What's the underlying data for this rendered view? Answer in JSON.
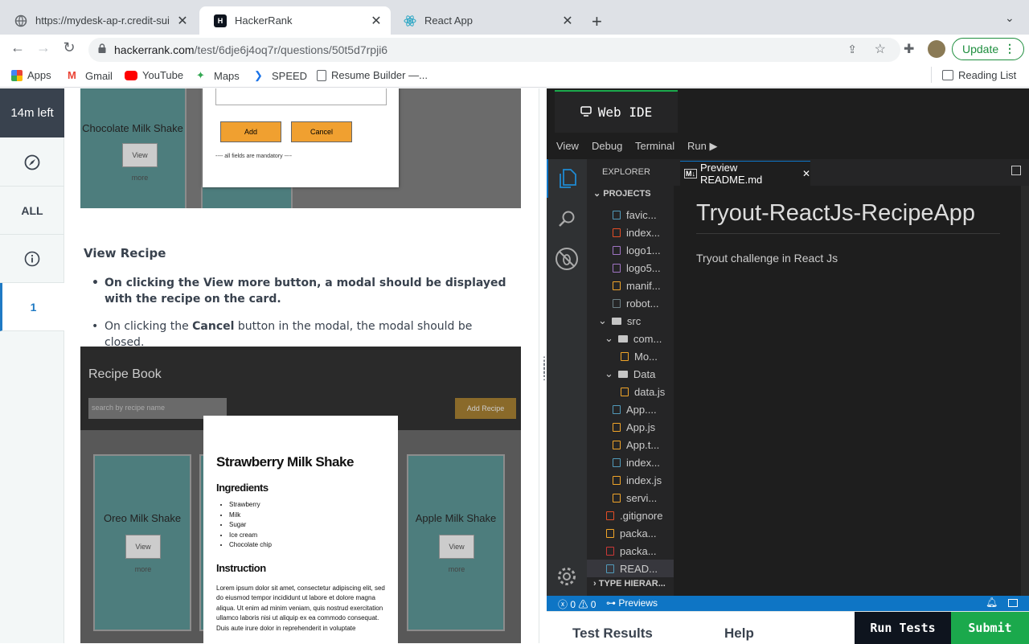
{
  "browser": {
    "tabs": [
      {
        "title": "https://mydesk-ap-r.credit-sui",
        "active": false
      },
      {
        "title": "HackerRank",
        "active": true
      },
      {
        "title": "React App",
        "active": false
      }
    ],
    "url_host": "hackerrank.com",
    "url_path": "/test/6dje6j4oq7r/questions/50t5d7rpji6",
    "update_label": "Update",
    "bookmarks": [
      "Apps",
      "Gmail",
      "YouTube",
      "Maps",
      "SPEED",
      "Resume Builder —...",
      "Reading List"
    ]
  },
  "rail": {
    "time_left": "14m left",
    "all_label": "ALL",
    "question_number": "1"
  },
  "question": {
    "section_title": "View Recipe",
    "bullet1_bold_a": "On clicking the View more button, a modal should be displayed with the recipe on the card.",
    "bullet2_pre": "On clicking the ",
    "bullet2_bold": "Cancel",
    "bullet2_post": " button in the modal, the modal should be closed.",
    "image1": {
      "card_title": "Chocolate Milk Shake",
      "view_more": "View more",
      "add": "Add",
      "cancel": "Cancel",
      "note": "---- all fields are mandatory ----"
    },
    "image2": {
      "app_title": "Recipe Book",
      "search_placeholder": "search by recipe name",
      "add_recipe": "Add Recipe",
      "modal_title": "Strawberry Milk Shake",
      "ingredients_heading": "Ingredients",
      "ingredients": [
        "Strawberry",
        "Milk",
        "Sugar",
        "Ice cream",
        "Chocolate chip"
      ],
      "instruction_heading": "Instruction",
      "instruction_text": "Lorem ipsum dolor sit amet, consectetur adipiscing elit, sed do eiusmod tempor incididunt ut labore et dolore magna aliqua. Ut enim ad minim veniam, quis nostrud exercitation ullamco laboris nisi ut aliquip ex ea commodo consequat. Duis aute irure dolor in reprehenderit in voluptate",
      "left_card": "Oreo Milk Shake",
      "right_card": "Apple Milk Shake",
      "view_more": "View more"
    }
  },
  "ide": {
    "title": "Web IDE",
    "menu": [
      "View",
      "Debug",
      "Terminal",
      "Run ▶"
    ],
    "explorer_label": "EXPLORER",
    "projects_label": "PROJECTS",
    "tree": [
      {
        "name": "favic...",
        "indent": 2,
        "kind": "file",
        "color": "#519aba"
      },
      {
        "name": "index...",
        "indent": 2,
        "kind": "file",
        "color": "#e44d26"
      },
      {
        "name": "logo1...",
        "indent": 2,
        "kind": "file",
        "color": "#a074c4"
      },
      {
        "name": "logo5...",
        "indent": 2,
        "kind": "file",
        "color": "#a074c4"
      },
      {
        "name": "manif...",
        "indent": 2,
        "kind": "file",
        "color": "#f1a529"
      },
      {
        "name": "robot...",
        "indent": 2,
        "kind": "file",
        "color": "#6d8086"
      },
      {
        "name": "src",
        "indent": 1,
        "kind": "folder"
      },
      {
        "name": "com...",
        "indent": 2,
        "kind": "folder"
      },
      {
        "name": "Mo...",
        "indent": 3,
        "kind": "file",
        "color": "#f1a529"
      },
      {
        "name": "Data",
        "indent": 2,
        "kind": "folder"
      },
      {
        "name": "data.js",
        "indent": 3,
        "kind": "file",
        "color": "#f1a529"
      },
      {
        "name": "App....",
        "indent": 2,
        "kind": "file",
        "color": "#519aba"
      },
      {
        "name": "App.js",
        "indent": 2,
        "kind": "file",
        "color": "#f1a529"
      },
      {
        "name": "App.t...",
        "indent": 2,
        "kind": "file",
        "color": "#f1a529"
      },
      {
        "name": "index...",
        "indent": 2,
        "kind": "file",
        "color": "#519aba"
      },
      {
        "name": "index.js",
        "indent": 2,
        "kind": "file",
        "color": "#f1a529"
      },
      {
        "name": "servi...",
        "indent": 2,
        "kind": "file",
        "color": "#f1a529"
      },
      {
        "name": ".gitignore",
        "indent": 1,
        "kind": "file",
        "color": "#e44d26"
      },
      {
        "name": "packa...",
        "indent": 1,
        "kind": "file",
        "color": "#f1a529"
      },
      {
        "name": "packa...",
        "indent": 1,
        "kind": "file",
        "color": "#cb3837"
      },
      {
        "name": "READ...",
        "indent": 1,
        "kind": "file",
        "color": "#519aba",
        "selected": true
      }
    ],
    "type_hierarchy": "TYPE HIERAR...",
    "editor_tab": "Preview README.md",
    "readme_title": "Tryout-ReactJs-RecipeApp",
    "readme_body": "Tryout challenge in React Js",
    "status_errors": "0",
    "status_warnings": "0",
    "status_previews": "Previews"
  },
  "bottom": {
    "test_results": "Test Results",
    "help": "Help",
    "run_tests": "Run Tests",
    "submit": "Submit"
  }
}
